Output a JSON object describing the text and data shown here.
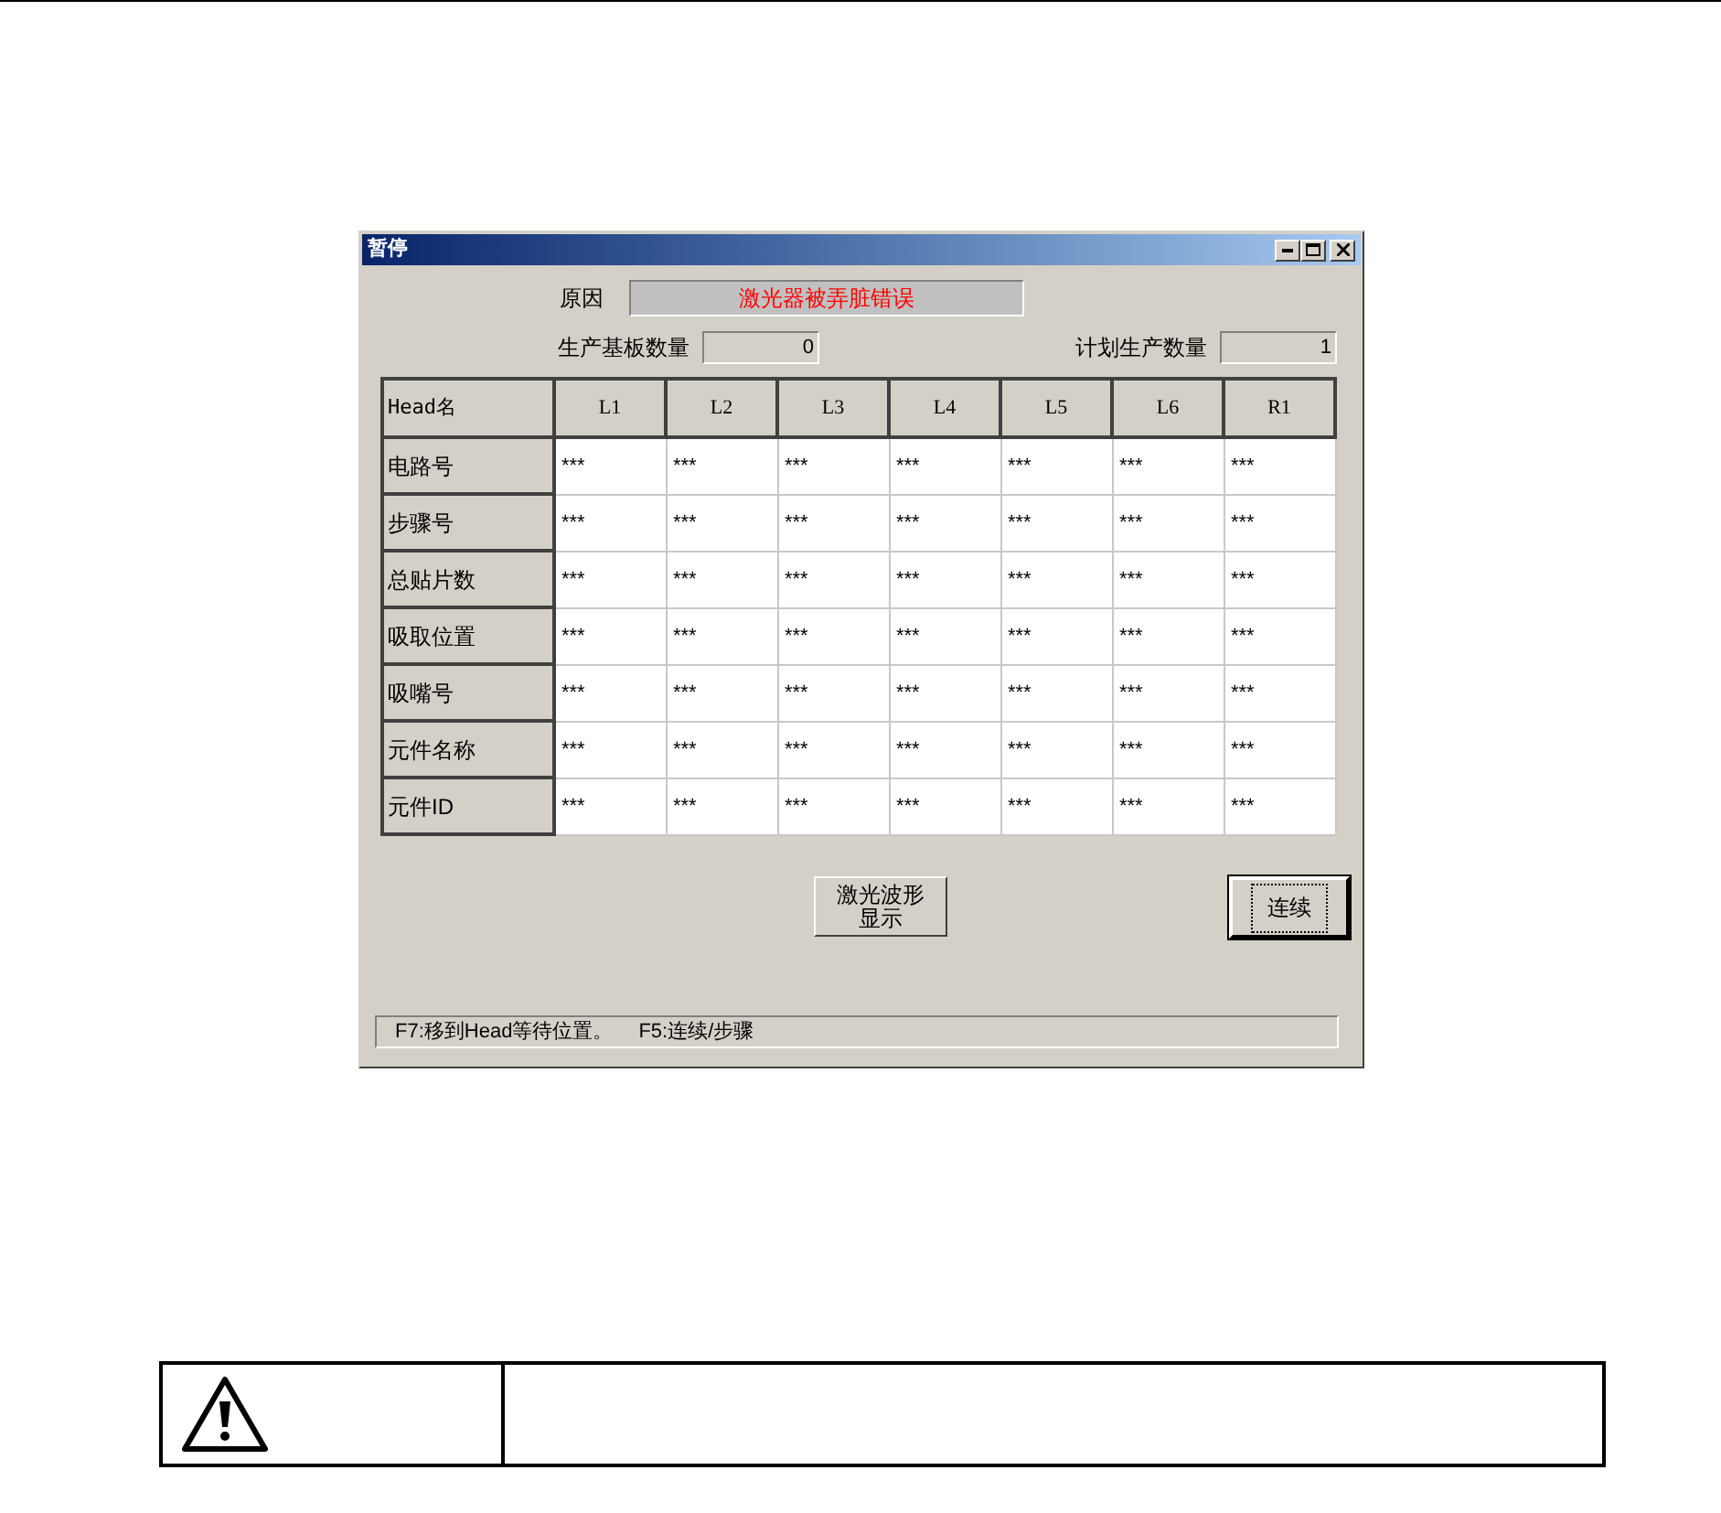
{
  "window": {
    "title": "暂停"
  },
  "reason": {
    "label": "原因",
    "value": "激光器被弄脏错误"
  },
  "counts": [
    {
      "label": "生产基板数量",
      "value": "0"
    },
    {
      "label": "计划生产数量",
      "value": "1"
    }
  ],
  "table": {
    "corner": "Head名",
    "columns": [
      "L1",
      "L2",
      "L3",
      "L4",
      "L5",
      "L6",
      "R1"
    ],
    "rows": [
      {
        "header": "电路号",
        "cells": [
          "***",
          "***",
          "***",
          "***",
          "***",
          "***",
          "***"
        ]
      },
      {
        "header": "步骤号",
        "cells": [
          "***",
          "***",
          "***",
          "***",
          "***",
          "***",
          "***"
        ]
      },
      {
        "header": "总贴片数",
        "cells": [
          "***",
          "***",
          "***",
          "***",
          "***",
          "***",
          "***"
        ]
      },
      {
        "header": "吸取位置",
        "cells": [
          "***",
          "***",
          "***",
          "***",
          "***",
          "***",
          "***"
        ]
      },
      {
        "header": "吸嘴号",
        "cells": [
          "***",
          "***",
          "***",
          "***",
          "***",
          "***",
          "***"
        ]
      },
      {
        "header": "元件名称",
        "cells": [
          "***",
          "***",
          "***",
          "***",
          "***",
          "***",
          "***"
        ]
      },
      {
        "header": "元件ID",
        "cells": [
          "***",
          "***",
          "***",
          "***",
          "***",
          "***",
          "***"
        ]
      }
    ]
  },
  "buttons": [
    {
      "label": "激光波形显示",
      "focused": false
    },
    {
      "label": "连续",
      "focused": true
    }
  ],
  "status_bar": [
    "F7:移到Head等待位置。",
    "F5:连续/步骤"
  ]
}
